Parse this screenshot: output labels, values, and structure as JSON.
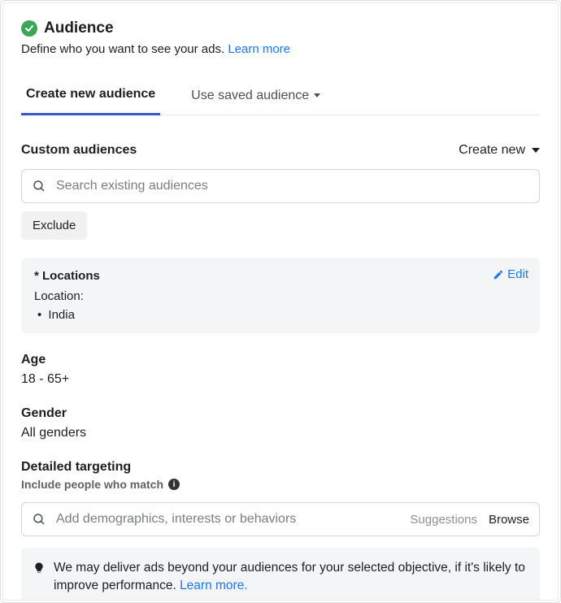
{
  "header": {
    "title": "Audience",
    "subtitle": "Define who you want to see your ads. ",
    "learn_more": "Learn more"
  },
  "tabs": {
    "create_new": "Create new audience",
    "use_saved": "Use saved audience"
  },
  "custom_audiences": {
    "label": "Custom audiences",
    "create_new": "Create new",
    "search_placeholder": "Search existing audiences",
    "exclude": "Exclude"
  },
  "locations": {
    "label": "* Locations",
    "edit": "Edit",
    "line_label": "Location:",
    "value": "India"
  },
  "age": {
    "label": "Age",
    "value": "18 - 65+"
  },
  "gender": {
    "label": "Gender",
    "value": "All genders"
  },
  "detailed": {
    "label": "Detailed targeting",
    "sublabel": "Include people who match",
    "search_placeholder": "Add demographics, interests or behaviors",
    "suggestions": "Suggestions",
    "browse": "Browse"
  },
  "delivery_note": {
    "text": "We may deliver ads beyond your audiences for your selected objective, if it's likely to improve performance. ",
    "learn_more": "Learn more."
  }
}
